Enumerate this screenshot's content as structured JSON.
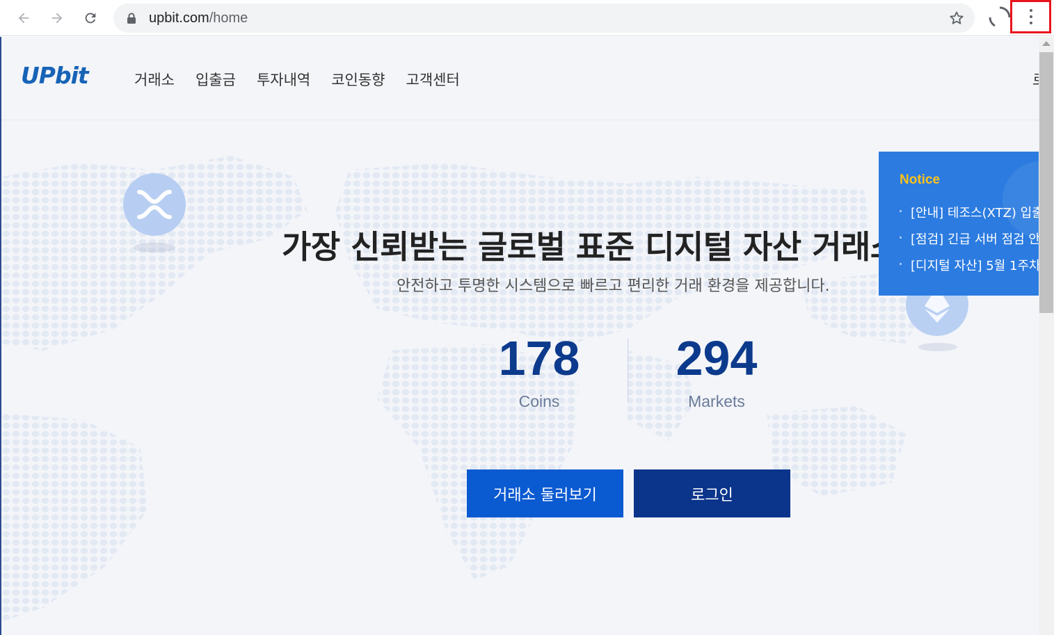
{
  "browser": {
    "url_host": "upbit.com",
    "url_path": "/home"
  },
  "header": {
    "logo": "UPbit",
    "nav": [
      "거래소",
      "입출금",
      "투자내역",
      "코인동향",
      "고객센터"
    ],
    "right_partial": "로"
  },
  "hero": {
    "title": "가장 신뢰받는 글로벌 표준 디지털 자산 거래소",
    "subtitle": "안전하고 투명한 시스템으로 빠르고 편리한 거래 환경을 제공합니다.",
    "stats": [
      {
        "value": "178",
        "label": "Coins"
      },
      {
        "value": "294",
        "label": "Markets"
      }
    ],
    "buttons": {
      "explore": "거래소 둘러보기",
      "login": "로그인"
    }
  },
  "notice": {
    "title": "Notice",
    "items": [
      "[안내] 테조스(XTZ) 입출금",
      "[점검] 긴급 서버 점검 안내",
      "[디지털 자산] 5월 1주차"
    ]
  },
  "colors": {
    "brand": "#1763b6",
    "primary_button": "#0a5ad1",
    "secondary_button": "#0b348b",
    "notice_bg": "#2b7be0",
    "notice_title": "#ffc21a",
    "stat_number": "#0c3a8c",
    "menu_highlight": "#e8141c"
  },
  "icons": [
    "back-arrow-icon",
    "forward-arrow-icon",
    "reload-icon",
    "lock-icon",
    "bookmark-star-icon",
    "loading-spinner-icon",
    "more-vert-icon",
    "xrp-coin-icon",
    "ethereum-coin-icon"
  ]
}
